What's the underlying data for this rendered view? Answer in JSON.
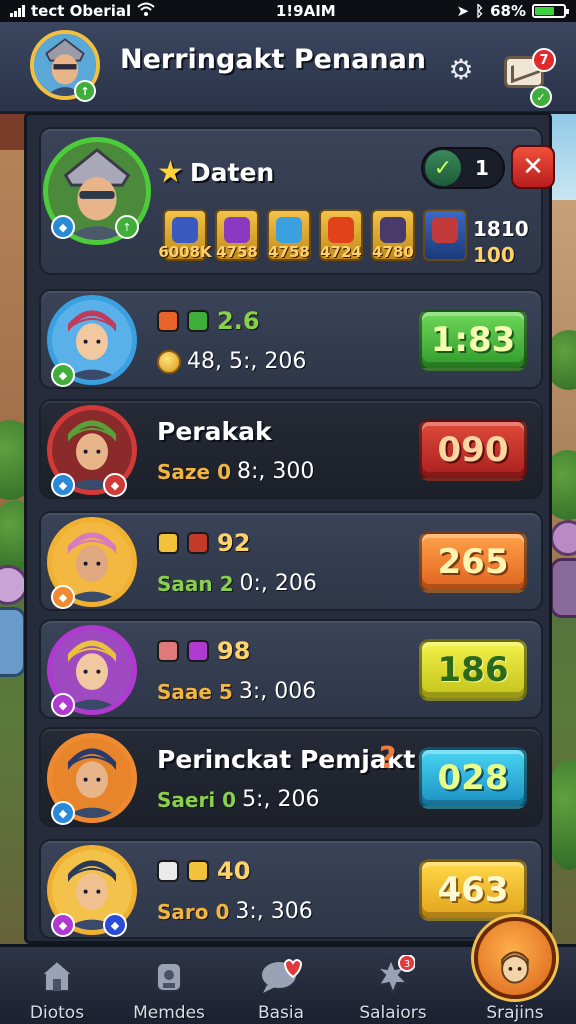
{
  "status_bar": {
    "carrier": "tect Oberial",
    "time": "1!9AIM",
    "battery": "68%",
    "battery_level": 0.68
  },
  "header": {
    "title": "Nerringakt Penanan",
    "mail_badge": "7"
  },
  "top_card": {
    "name": "Daten",
    "toggle_value": "1",
    "items": [
      {
        "value": "6008K",
        "color": "#3a5ac2"
      },
      {
        "value": "4758",
        "color": "#8a3ac2"
      },
      {
        "value": "4758",
        "color": "#3aa0e0"
      },
      {
        "value": "4724",
        "color": "#e0421a"
      },
      {
        "value": "4780",
        "color": "#4a3a6a"
      },
      {
        "value": "",
        "color": "#c23a3a"
      }
    ],
    "stat_top": "1810",
    "stat_bottom": "100"
  },
  "rows": [
    {
      "name": "",
      "stat_top": "2.6",
      "stat_bottom": "48, 5:, 206",
      "prefix": "",
      "score": "1:83",
      "score_color": "green"
    },
    {
      "name": "Perakak",
      "stat_top": "",
      "stat_bottom": "8:, 300",
      "prefix": "Saze 0",
      "score": "090",
      "score_color": "red"
    },
    {
      "name": "",
      "stat_top": "92",
      "stat_bottom": "0:, 206",
      "prefix": "Saan 2",
      "score": "265",
      "score_color": "orange"
    },
    {
      "name": "",
      "stat_top": "98",
      "stat_bottom": "3:, 006",
      "prefix": "Saae 5",
      "score": "186",
      "score_color": "yellow"
    },
    {
      "name": "Perinckat Pemjakt",
      "stat_top": "",
      "stat_bottom": "5:, 206",
      "prefix": "Saeri 0",
      "score": "028",
      "score_color": "cyan"
    },
    {
      "name": "",
      "stat_top": "40",
      "stat_bottom": "3:, 306",
      "prefix": "Saro 0",
      "score": "463",
      "score_color": "gold"
    }
  ],
  "bottom_nav": [
    {
      "label": "Diotos",
      "icon": "home-icon"
    },
    {
      "label": "Memdes",
      "icon": "backpack-icon"
    },
    {
      "label": "Basia",
      "icon": "heart-chat-icon"
    },
    {
      "label": "Salaiors",
      "icon": "spiky-ball-icon"
    },
    {
      "label": "Srajins",
      "icon": "character-icon"
    }
  ]
}
